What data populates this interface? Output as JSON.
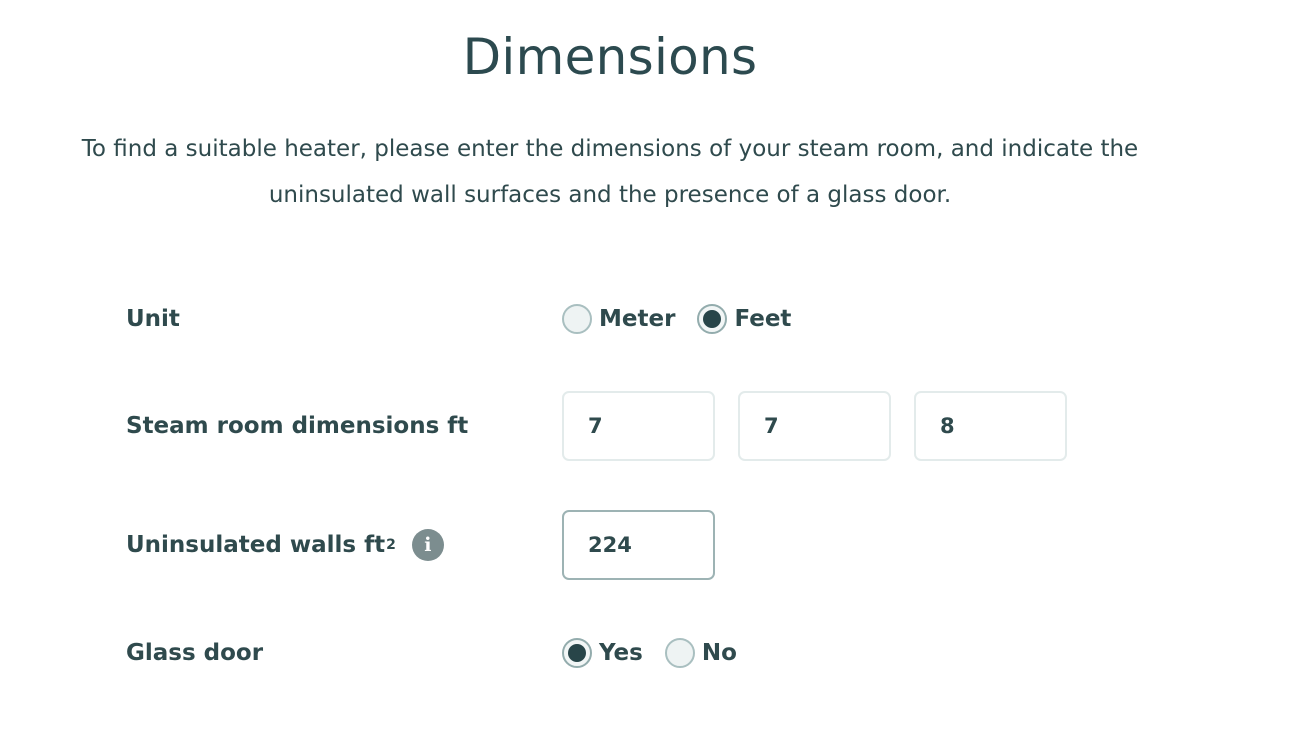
{
  "page": {
    "title": "Dimensions",
    "intro_line1": "To find a suitable heater, please enter the dimensions of your steam room, and indicate the",
    "intro_line2": "uninsulated wall surfaces and the presence of a glass door."
  },
  "colors": {
    "text": "#2f4a4d",
    "radio_fill": "#284549",
    "input_border": "#e3ebeb",
    "input_border_active": "#9db3b4",
    "info_icon_bg": "#7c8d8f"
  },
  "unit": {
    "label": "Unit",
    "options": [
      {
        "label": "Meter",
        "checked": false
      },
      {
        "label": "Feet",
        "checked": true
      }
    ]
  },
  "dimensions": {
    "label": "Steam room dimensions ft",
    "values": [
      "7",
      "7",
      "8"
    ]
  },
  "uninsulated": {
    "label": "Uninsulated walls ft",
    "superscript": "2",
    "value": "224",
    "info_icon": "info-icon",
    "info_glyph": "i"
  },
  "glass_door": {
    "label": "Glass door",
    "options": [
      {
        "label": "Yes",
        "checked": true
      },
      {
        "label": "No",
        "checked": false
      }
    ]
  }
}
